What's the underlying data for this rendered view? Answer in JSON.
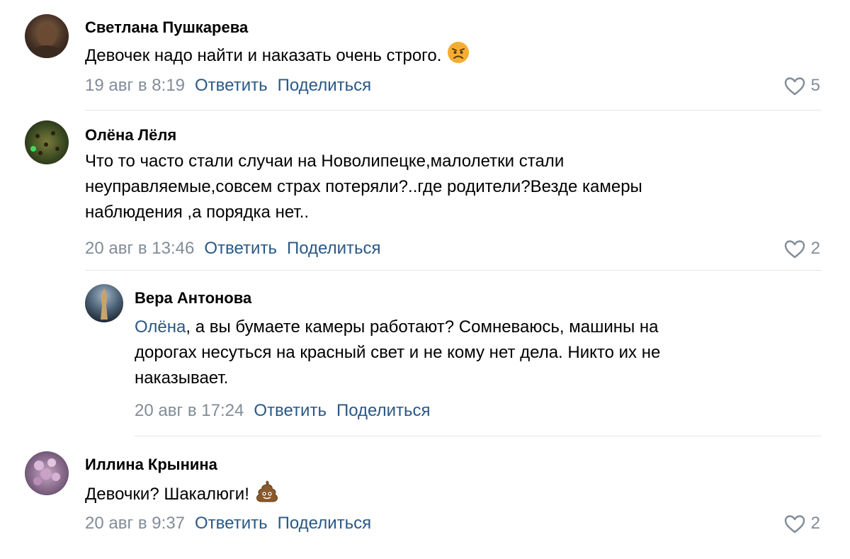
{
  "comments": [
    {
      "author": "Светлана Пушкарева",
      "text": "Девочек надо найти и наказать очень строго.",
      "emoji": "angry-face",
      "time": "19 авг в 8:19",
      "reply_label": "Ответить",
      "share_label": "Поделиться",
      "likes": "5"
    },
    {
      "author": "Олёна Лёля",
      "text_lines": [
        "Что то часто стали случаи на Новолипецке,малолетки стали",
        "неуправляемые,совсем страх потеряли?..где родители?Везде камеры",
        "наблюдения ,а порядка нет.."
      ],
      "time": "20 авг в 13:46",
      "reply_label": "Ответить",
      "share_label": "Поделиться",
      "likes": "2"
    },
    {
      "author": "Вера Антонова",
      "mention": "Олёна",
      "text_lines": [
        ", а вы бумаете камеры работают? Сомневаюсь, машины на",
        "дорогах несуться на красный свет и не кому нет дела. Никто их не",
        "наказывает."
      ],
      "time": "20 авг в 17:24",
      "reply_label": "Ответить",
      "share_label": "Поделиться"
    },
    {
      "author": "Иллина Крынина",
      "text": "Девочки? Шакалюги!",
      "emoji": "poop",
      "time": "20 авг в 9:37",
      "reply_label": "Ответить",
      "share_label": "Поделиться",
      "likes": "2"
    }
  ],
  "colors": {
    "link": "#2a5885",
    "meta": "#818c99",
    "separator": "#e3e6ea"
  },
  "icons": {
    "like": "heart-outline-icon"
  }
}
